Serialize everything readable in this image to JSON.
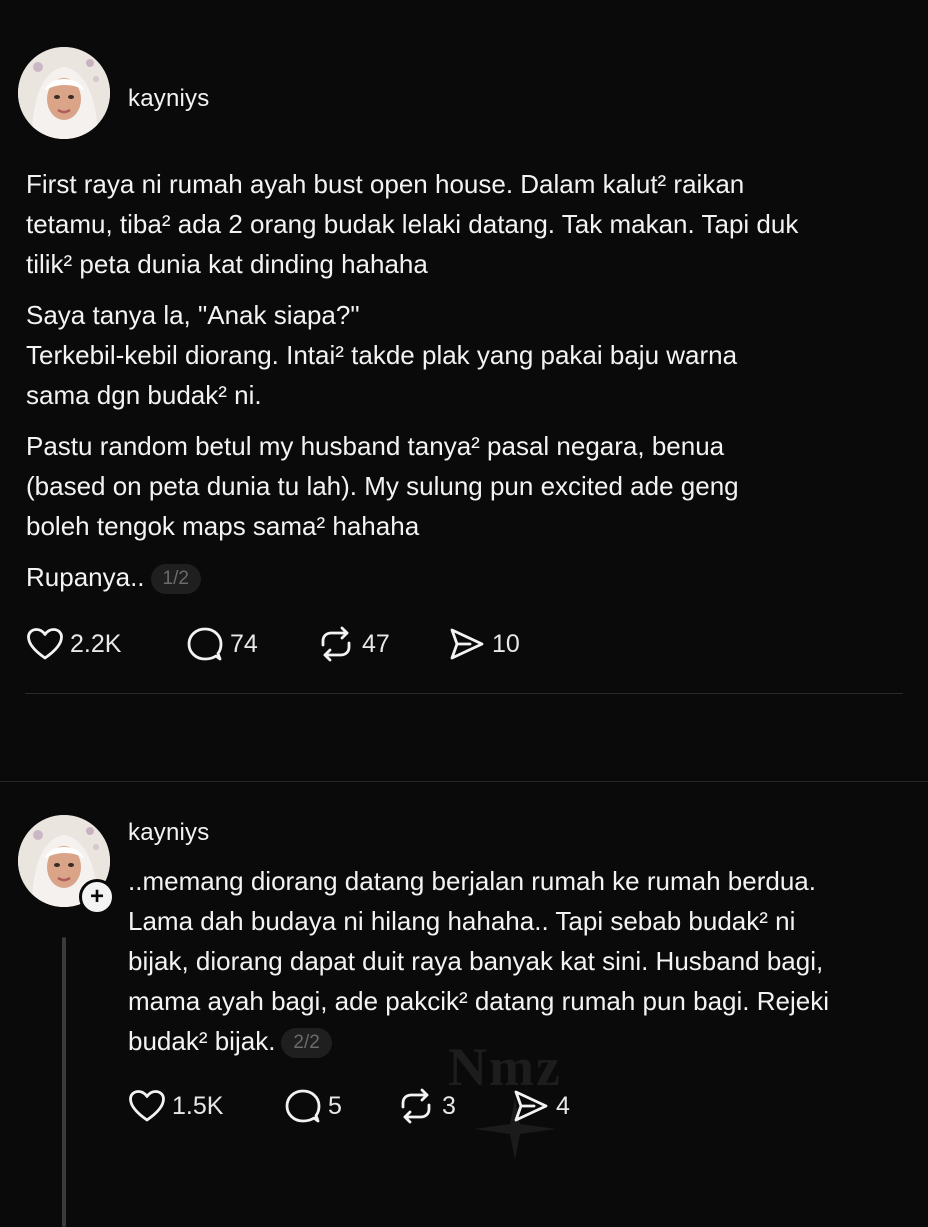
{
  "posts": [
    {
      "username": "kayniys",
      "paragraphs": [
        [
          "First raya ni rumah ayah bust open house. Dalam kalut² raikan",
          "tetamu, tiba² ada 2 orang budak lelaki datang. Tak makan. Tapi duk",
          "tilik² peta dunia kat dinding hahaha"
        ],
        [
          "Saya tanya la, \"Anak siapa?\"",
          "Terkebil-kebil diorang. Intai² takde plak yang pakai baju warna",
          "sama dgn budak² ni."
        ],
        [
          "Pastu random betul my husband tanya² pasal negara, benua",
          "(based on peta dunia tu lah). My sulung pun excited ade geng",
          "boleh tengok maps sama² hahaha"
        ]
      ],
      "closing_text": "Rupanya..",
      "page_indicator": "1/2",
      "stats": {
        "likes": "2.2K",
        "replies": "74",
        "reposts": "47",
        "shares": "10"
      }
    },
    {
      "username": "kayniys",
      "lines": [
        "..memang diorang datang berjalan rumah ke rumah berdua.",
        "Lama dah budaya ni hilang hahaha.. Tapi sebab budak² ni",
        "bijak, diorang dapat duit raya banyak kat sini. Husband bagi,",
        "mama ayah bagi, ade pakcik² datang rumah pun bagi. Rejeki"
      ],
      "last_line": "budak² bijak.",
      "page_indicator": "2/2",
      "follow_symbol": "+",
      "stats": {
        "likes": "1.5K",
        "replies": "5",
        "reposts": "3",
        "shares": "4"
      }
    }
  ],
  "watermark": "Nmz",
  "icons": {
    "like": "heart-icon",
    "reply": "speech-bubble-icon",
    "repost": "repost-arrows-icon",
    "share": "send-icon"
  },
  "colors": {
    "background": "#0a0a0a",
    "text": "#f3f3f3",
    "muted": "#6b6b6b",
    "divider": "#2a2a2a"
  }
}
